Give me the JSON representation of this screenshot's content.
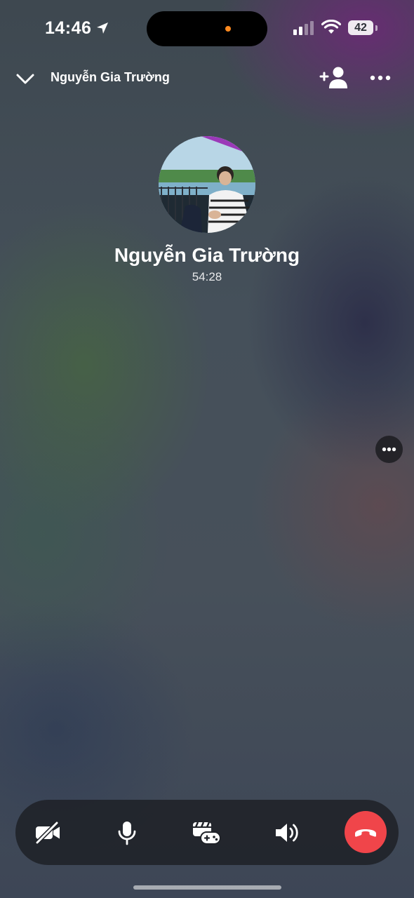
{
  "status_bar": {
    "time": "14:46",
    "battery": "42",
    "icons": [
      "location-arrow-icon",
      "signal-icon",
      "wifi-icon",
      "battery-icon"
    ],
    "recording_dot_color": "#ff8a1f"
  },
  "header": {
    "title": "Nguyễn Gia Trường",
    "icons": [
      "chevron-down-icon",
      "add-person-icon",
      "more-icon"
    ]
  },
  "call": {
    "caller_name": "Nguyễn Gia Trường",
    "duration": "54:28"
  },
  "controls": {
    "buttons": [
      "video-off-icon",
      "microphone-icon",
      "effects-games-icon",
      "speaker-icon",
      "end-call-icon"
    ],
    "end_call_color": "#f0454a"
  }
}
